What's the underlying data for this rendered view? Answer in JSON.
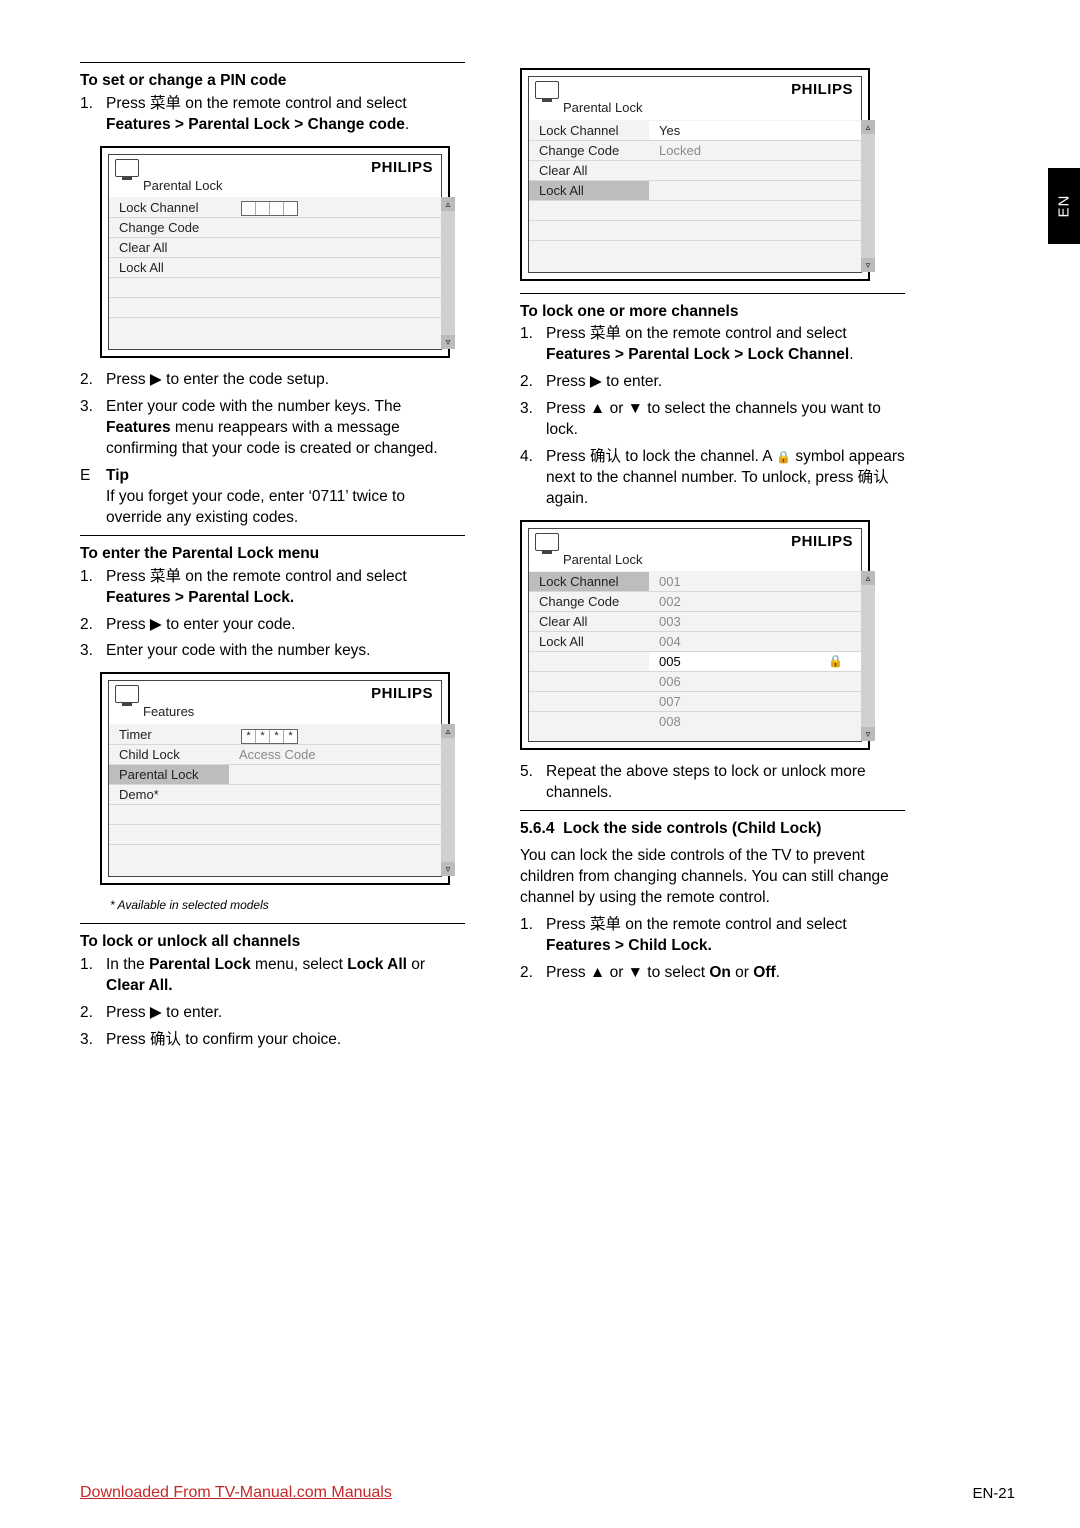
{
  "lang_tab": "EN",
  "brand": "PHILIPS",
  "left": {
    "sec1_title": "To set or change a PIN code",
    "sec1_step1_pre": "Press ",
    "sec1_step1_cjk": "菜单",
    "sec1_step1_post": " on the remote control and select ",
    "sec1_step1_bold": "Features > Parental Lock > Change code",
    "osd1_crumb": "Parental Lock",
    "osd1_items": [
      "Lock Channel",
      "Change Code",
      "Clear All",
      "Lock All"
    ],
    "sec1_step2": "Press ▶ to enter the code setup.",
    "sec1_step3_a": "Enter your code with the number keys. The ",
    "sec1_step3_bold": "Features",
    "sec1_step3_b": " menu reappears with a message confirming that your code is created or changed.",
    "tip_E": "E",
    "tip_label": "Tip",
    "tip_body": "If you forget your code, enter ‘0711’ twice to override any existing codes.",
    "sec2_title": "To enter the Parental Lock menu",
    "sec2_step1_pre": "Press ",
    "sec2_step1_cjk": "菜单",
    "sec2_step1_post": " on the remote control and select ",
    "sec2_step1_bold": "Features > Parental Lock.",
    "sec2_step2": "Press ▶ to enter your code.",
    "sec2_step3": "Enter your code with the number keys.",
    "osd2_crumb": "Features",
    "osd2_items": [
      "Timer",
      "Child Lock",
      "Parental Lock",
      "Demo*"
    ],
    "osd2_right_label": "Access Code",
    "footnote": "* Available in selected models",
    "sec3_title": "To lock or unlock all channels",
    "sec3_step1_a": "In the ",
    "sec3_step1_b1": "Parental Lock",
    "sec3_step1_mid": " menu, select ",
    "sec3_step1_b2": "Lock All",
    "sec3_step1_or": " or ",
    "sec3_step1_b3": "Clear All.",
    "sec3_step2": "Press ▶ to enter.",
    "sec3_step3_pre": "Press ",
    "sec3_step3_cjk": "确认",
    "sec3_step3_post": " to confirm your choice."
  },
  "right": {
    "osd3_crumb": "Parental Lock",
    "osd3_items": [
      "Lock Channel",
      "Change Code",
      "Clear All",
      "Lock All"
    ],
    "osd3_val1": "Yes",
    "osd3_val2": "Locked",
    "sec4_title": "To lock one or more channels",
    "sec4_step1_pre": "Press ",
    "sec4_step1_cjk": "菜单",
    "sec4_step1_post": " on the remote control and select ",
    "sec4_step1_bold": "Features > Parental Lock > Lock Channel",
    "sec4_step2": "Press ▶ to enter.",
    "sec4_step3": "Press ▲ or ▼ to select the channels you want to lock.",
    "sec4_step4_pre": "Press ",
    "sec4_step4_cjk1": "确认",
    "sec4_step4_mid": " to lock the channel. A ",
    "sec4_step4_post": " symbol appears next to the channel number. To unlock, press ",
    "sec4_step4_cjk2": "确认",
    "sec4_step4_end": " again.",
    "osd4_crumb": "Parental Lock",
    "osd4_left_items": [
      "Lock Channel",
      "Change Code",
      "Clear All",
      "Lock All"
    ],
    "osd4_channels": [
      "001",
      "002",
      "003",
      "004",
      "005",
      "006",
      "007",
      "008"
    ],
    "osd4_locked_index": 4,
    "sec4_step5": "Repeat the above steps to lock or unlock more channels.",
    "sec5_num": "5.6.4",
    "sec5_title": "Lock the side controls (Child Lock)",
    "sec5_intro": "You can lock the side controls of the TV to prevent children from changing channels. You can still change channel by using the remote control.",
    "sec5_step1_pre": "Press ",
    "sec5_step1_cjk": "菜单",
    "sec5_step1_post": " on the remote control and select ",
    "sec5_step1_bold": "Features > Child Lock.",
    "sec5_step2_a": "Press ▲ or ▼ to select ",
    "sec5_step2_b1": "On",
    "sec5_step2_or": " or ",
    "sec5_step2_b2": "Off",
    "sec5_step2_end": "."
  },
  "footer_link": "Downloaded From TV-Manual.com Manuals",
  "page_num": "EN-21"
}
